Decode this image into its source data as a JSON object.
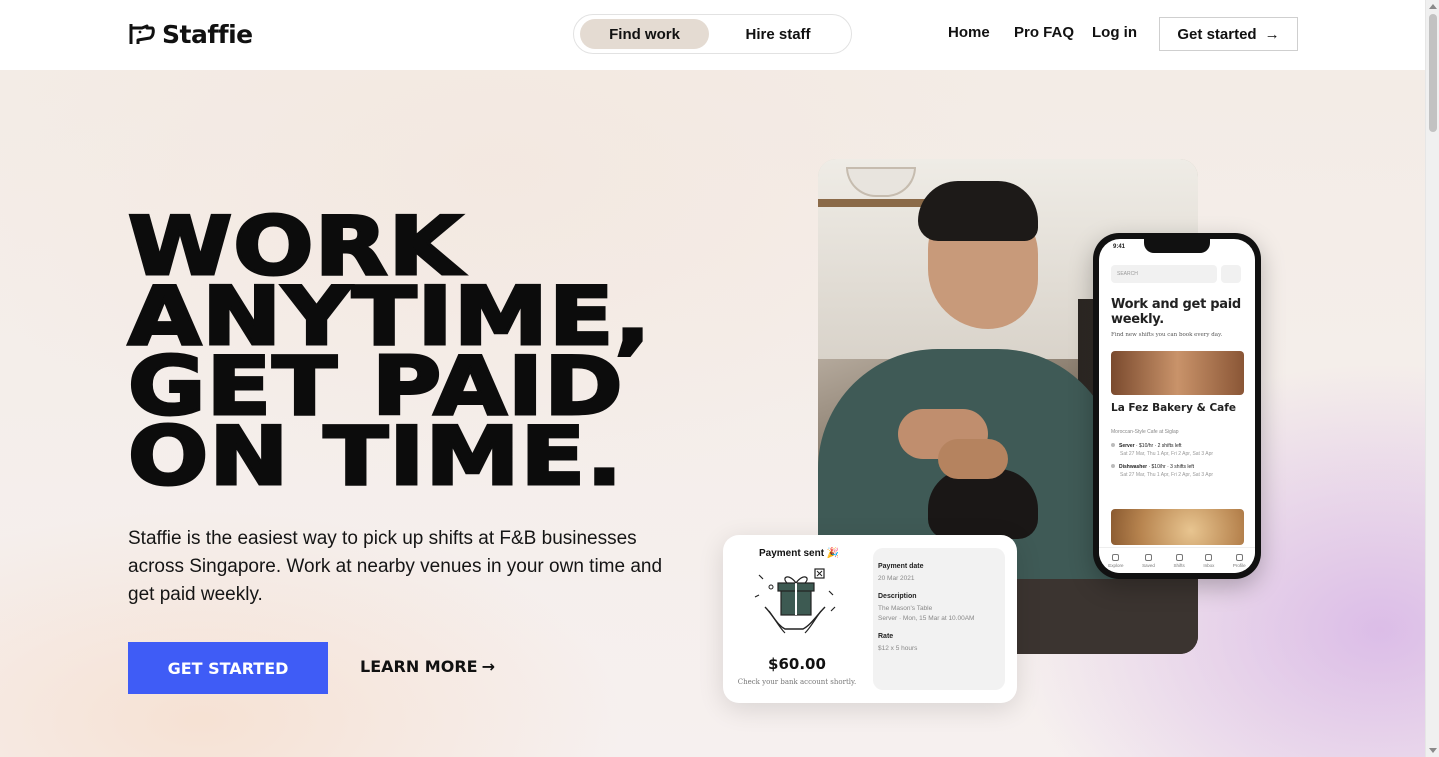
{
  "header": {
    "brand": "Staffie",
    "toggle": {
      "active": "Find work",
      "inactive": "Hire staff"
    },
    "nav": {
      "home": "Home",
      "faq": "Pro FAQ",
      "login": "Log in"
    },
    "cta": "Get started",
    "cta_arrow": "→"
  },
  "hero": {
    "headline": [
      "WORK",
      "ANYTIME,",
      "GET PAID",
      "ON TIME."
    ],
    "subtext": "Staffie is the easiest way to pick up shifts at F&B businesses across Singapore. Work at nearby venues in your own time and get paid weekly.",
    "primary_button": "GET STARTED",
    "secondary_button": "LEARN MORE",
    "secondary_arrow": "→"
  },
  "phone": {
    "time": "9:41",
    "search_placeholder": "SEARCH",
    "title": "Work and get paid weekly.",
    "subtitle": "Find new shifts you can book every day.",
    "venue_name": "La Fez Bakery & Cafe",
    "venue_desc": "Moroccan-Style Cafe at Siglap",
    "shifts": [
      {
        "role": "Server",
        "info": " · $10/hr · 2 shifts left",
        "dates": "Sat 27 Mar, Thu 1 Apr, Fri 2 Apr, Sat 3 Apr"
      },
      {
        "role": "Dishwasher",
        "info": " · $10/hr · 3 shifts left",
        "dates": "Sat 27 Mar, Thu 1 Apr, Fri 2 Apr, Sat 3 Apr"
      }
    ],
    "tabs": [
      "Explore",
      "Saved",
      "Shifts",
      "Inbox",
      "Profile"
    ]
  },
  "payment": {
    "title": "Payment sent 🎉",
    "amount": "$60.00",
    "note": "Check your bank account shortly.",
    "date_label": "Payment date",
    "date_value": "20 Mar 2021",
    "desc_label": "Description",
    "desc_value_1": "The Mason's Table",
    "desc_value_2": "Server · Mon, 15 Mar at 10.00AM",
    "rate_label": "Rate",
    "rate_value": "$12 x 5 hours"
  },
  "colors": {
    "primary_button": "#3f5cf6",
    "toggle_active": "#e4dbd2",
    "hero_accent_pink": "#d7b4e6"
  }
}
